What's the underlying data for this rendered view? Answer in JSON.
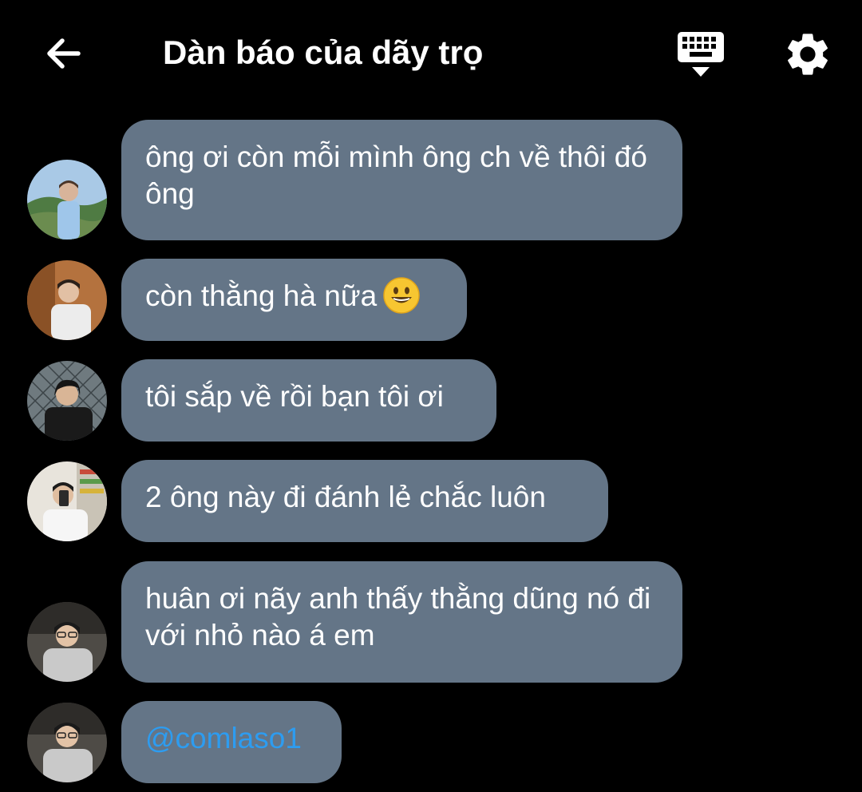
{
  "header": {
    "title": "Dàn báo của dãy trọ",
    "back_icon": "back-arrow-icon",
    "keyboard_icon": "keyboard-icon",
    "settings_icon": "gear-icon"
  },
  "messages": [
    {
      "text": "ông ơi còn mỗi mình ông ch về thôi đó ông",
      "avatar": "avatar-user-1"
    },
    {
      "text": "còn thằng hà nữa",
      "emoji": "grinning-face-emoji",
      "avatar": "avatar-user-2"
    },
    {
      "text": "tôi sắp về rồi bạn tôi ơi",
      "avatar": "avatar-user-3"
    },
    {
      "text": "2 ông này đi đánh lẻ chắc luôn",
      "avatar": "avatar-user-4"
    },
    {
      "text": "huân ơi nãy anh thấy thằng dũng nó đi với nhỏ nào á em",
      "avatar": "avatar-user-5"
    },
    {
      "mention": "@comlaso1",
      "avatar": "avatar-user-5"
    }
  ],
  "colors": {
    "background": "#000000",
    "bubble": "#647587",
    "mention": "#2d9cf0",
    "text": "#ffffff"
  }
}
